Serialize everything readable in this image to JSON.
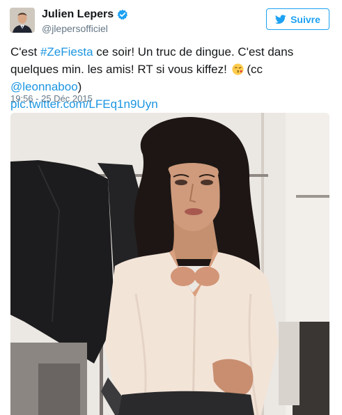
{
  "author": {
    "display_name": "Julien Lepers",
    "handle": "@jlepersofficiel",
    "verified": true,
    "avatar_icon": "profile-photo"
  },
  "follow_button": {
    "label": "Suivre",
    "icon": "twitter-bird-icon",
    "color": "#1da1f2"
  },
  "tweet": {
    "text_before_hashtag": "C'est ",
    "hashtag": "#ZeFiesta",
    "text_after_hashtag": " ce soir! Un truc de dingue. C'est dans quelques min. les amis! RT si vous kiffez! ",
    "emoji": "face-throwing-kiss",
    "text_before_mention": " (cc ",
    "mention": "@leonnaboo",
    "text_after_mention": ")",
    "media_link": "pic.twitter.com/LFEq1n9Uyn",
    "timestamp": "19:56 - 25 Déc 2015"
  },
  "media": {
    "description_icon": "photo"
  },
  "colors": {
    "link": "#1b95e0",
    "secondary_text": "#657786",
    "primary_text": "#14171a"
  }
}
